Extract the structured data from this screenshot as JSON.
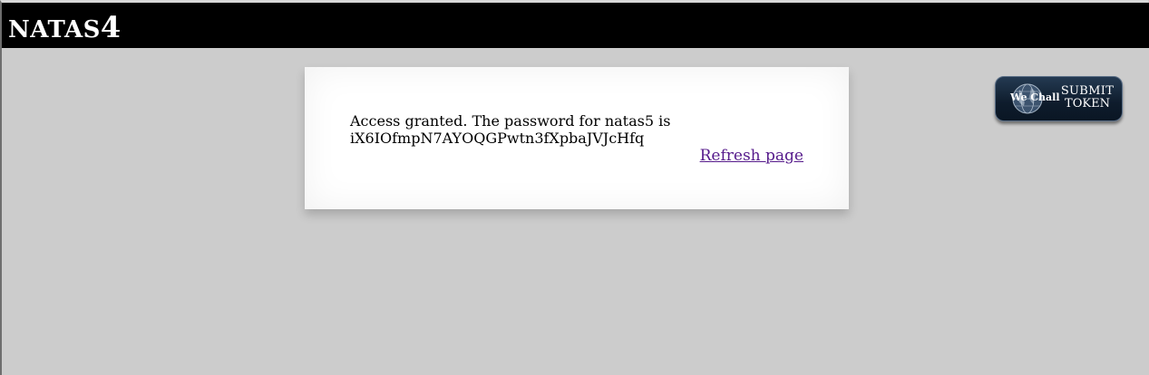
{
  "header": {
    "title_prefix": "NATAS",
    "title_number": "4"
  },
  "content": {
    "message_line1": "Access granted. The password for natas5 is",
    "message_line2": "iX6IOfmpN7AYOQGPwtn3fXpbaJVJcHfq",
    "refresh_label": "Refresh page"
  },
  "wechall": {
    "logo_text": "We Chall",
    "submit_line1": "SUBMIT",
    "submit_line2": "TOKEN",
    "icon": "globe-icon"
  },
  "colors": {
    "topbar": "#000000",
    "background": "#cccccc",
    "link_visited": "#551a8b",
    "button_bg": "#0e1c2c"
  }
}
